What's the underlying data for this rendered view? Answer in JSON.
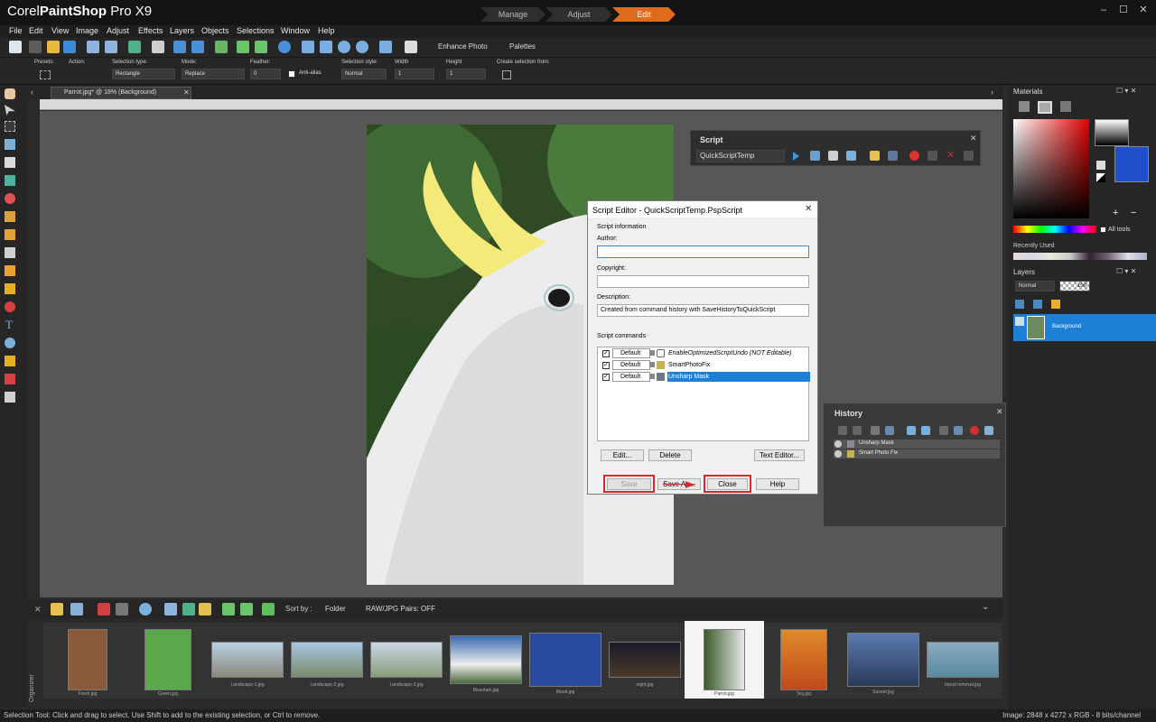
{
  "app": {
    "name_light": "Corel",
    "name_bold": "PaintShop",
    "name_tail": " Pro X9"
  },
  "workspace_tabs": [
    "Manage",
    "Adjust",
    "Edit"
  ],
  "menu": [
    "File",
    "Edit",
    "View",
    "Image",
    "Adjust",
    "Effects",
    "Layers",
    "Objects",
    "Selections",
    "Window",
    "Help"
  ],
  "toolbar": {
    "enhance_photo": "Enhance Photo",
    "palettes": "Palettes"
  },
  "options": {
    "presets_label": "Presets:",
    "action_label": "Action:",
    "selection_type_label": "Selection type:",
    "selection_type_value": "Rectangle",
    "mode_label": "Mode:",
    "mode_value": "Replace",
    "feather_label": "Feather:",
    "feather_value": "0",
    "antialias_label": "Anti-alias",
    "selection_style_label": "Selection style:",
    "selection_style_value": "Normal",
    "width_label": "Width",
    "width_value": "1",
    "height_label": "Height",
    "height_value": "1",
    "create_from_label": "Create selection from:"
  },
  "document_tab": {
    "label": "Parrot.jpg* @  18% (Background)"
  },
  "script_palette": {
    "title": "Script",
    "script_name": "QuickScriptTemp"
  },
  "script_editor": {
    "title": "Script Editor - QuickScriptTemp.PspScript",
    "info_label": "Script information",
    "author_label": "Author:",
    "author_value": "",
    "copyright_label": "Copyright:",
    "copyright_value": "",
    "description_label": "Description:",
    "description_value": "Created from command history with SaveHistoryToQuickScript",
    "commands_label": "Script commands",
    "commands": [
      {
        "mode": "Default",
        "name": "EnableOptimizedScriptUndo (NOT Editable)"
      },
      {
        "mode": "Default",
        "name": "SmartPhotoFix"
      },
      {
        "mode": "Default",
        "name": "Unsharp Mask"
      }
    ],
    "edit_button": "Edit...",
    "delete_button": "Delete",
    "text_editor_button": "Text Editor...",
    "save_button": "Save",
    "save_as_button": "Save As...",
    "close_button": "Close",
    "help_button": "Help"
  },
  "history": {
    "title": "History",
    "items": [
      "Unsharp Mask",
      "Smart Photo Fix"
    ]
  },
  "materials": {
    "title": "Materials",
    "all_tools": "All tools",
    "recently_used": "Recently Used"
  },
  "layers": {
    "title": "Layers",
    "blend_mode": "Normal",
    "opacity": "100",
    "layer_name": "Background"
  },
  "organizer": {
    "label": "Organizer",
    "sort_by_label": "Sort by :",
    "sort_value": "Folder",
    "raw_pairs": "RAW/JPG Pairs: OFF",
    "thumbnails": [
      "Fresh.jpg",
      "Green.jpg",
      "Landscape-1.jpg",
      "Landscape-2.jpg",
      "Landscape-3.jpg",
      "Mountain.jpg",
      "Mural.jpg",
      "night.jpg",
      "Parrot.jpg",
      "Sky.jpg",
      "Sunset.jpg",
      "tripod removal.jpg"
    ]
  },
  "status": {
    "left": "Selection Tool: Click and drag to select. Use Shift to add to the existing selection, or Ctrl to remove.",
    "right": "Image:  2848 x 4272 x RGB - 8 bits/channel"
  },
  "colors": {
    "accent": "#e06a1c",
    "selection": "#1e7fd6",
    "highlight_red": "#d22b2b"
  }
}
